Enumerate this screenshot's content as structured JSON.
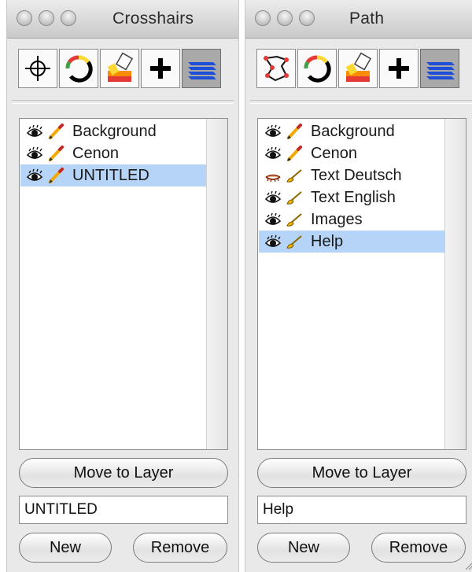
{
  "left": {
    "title": "Crosshairs",
    "tools": [
      "crosshairs-icon",
      "color-wheel-icon",
      "paint-fill-icon",
      "plus-icon",
      "layers-icon"
    ],
    "layers": [
      {
        "label": "Background",
        "visibility": "eye-open",
        "edit": "pencil",
        "selected": false
      },
      {
        "label": "Cenon",
        "visibility": "eye-open",
        "edit": "pencil",
        "selected": false
      },
      {
        "label": "UNTITLED",
        "visibility": "eye-open",
        "edit": "pencil",
        "selected": true
      }
    ],
    "move_label": "Move to Layer",
    "name_value": "UNTITLED",
    "new_label": "New",
    "remove_label": "Remove"
  },
  "right": {
    "title": "Path",
    "tools": [
      "path-icon",
      "color-wheel-icon",
      "paint-fill-icon",
      "plus-icon",
      "layers-icon"
    ],
    "layers": [
      {
        "label": "Background",
        "visibility": "eye-open",
        "edit": "pencil",
        "selected": false
      },
      {
        "label": "Cenon",
        "visibility": "eye-open",
        "edit": "pencil",
        "selected": false
      },
      {
        "label": "Text Deutsch",
        "visibility": "eye-closed",
        "edit": "brush",
        "selected": false
      },
      {
        "label": "Text English",
        "visibility": "eye-open",
        "edit": "brush",
        "selected": false
      },
      {
        "label": "Images",
        "visibility": "eye-open",
        "edit": "brush",
        "selected": false
      },
      {
        "label": "Help",
        "visibility": "eye-open",
        "edit": "brush",
        "selected": true
      }
    ],
    "move_label": "Move to Layer",
    "name_value": "Help",
    "new_label": "New",
    "remove_label": "Remove"
  },
  "colors": {
    "selection": "#b6d4f7",
    "panel": "#e9e9e9"
  }
}
